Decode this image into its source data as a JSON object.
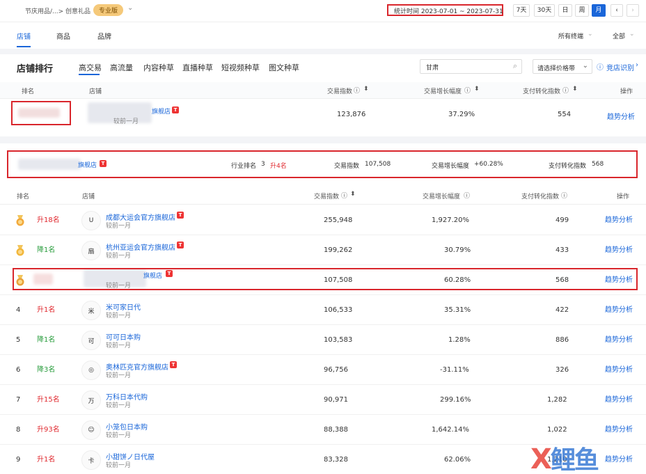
{
  "breadcrumb": {
    "path": "节庆用品/...> 创意礼品",
    "badge": "专业版"
  },
  "date_range": "统计时间 2023-07-01 ~ 2023-07-31",
  "period_buttons": [
    "7天",
    "30天",
    "日",
    "周",
    "月"
  ],
  "nav_tabs": [
    "店铺",
    "商品",
    "品牌"
  ],
  "filters": {
    "terminal": "所有终端",
    "scope": "全部"
  },
  "section_title": "店铺排行",
  "sub_tabs": [
    "高交易",
    "高流量",
    "内容种草",
    "直播种草",
    "短视频种草",
    "图文种草"
  ],
  "search": {
    "value": "甘肃"
  },
  "price_select": "请选择价格带",
  "identify_link": "竞店识别",
  "columns": {
    "rank": "排名",
    "shop": "店铺",
    "trade": "交易指数",
    "growth": "交易增长幅度",
    "conversion": "支付转化指数",
    "action": "操作"
  },
  "pinned_row": {
    "shop_suffix": "旗舰店",
    "compare": "较前一月",
    "trade": "123,876",
    "growth": "37.29%",
    "conversion": "554",
    "action": "趋势分析"
  },
  "summary": {
    "shop_suffix": "旗舰店",
    "industry_rank_label": "行业排名",
    "industry_rank": "3",
    "rank_change": "升4名",
    "trade_label": "交易指数",
    "trade": "107,508",
    "growth_label": "交易增长幅度",
    "growth": "+60.28%",
    "conversion_label": "支付转化指数",
    "conversion": "568"
  },
  "rows": [
    {
      "rank": "",
      "change": "升18名",
      "dir": "up",
      "name": "成都大运会官方旗舰店",
      "tmall": true,
      "compare": "较前一月",
      "trade": "255,948",
      "growth": "1,927.20%",
      "conversion": "499",
      "action": "趋势分析"
    },
    {
      "rank": "",
      "change": "降1名",
      "dir": "down",
      "name": "杭州亚运会官方旗舰店",
      "tmall": true,
      "compare": "较前一月",
      "trade": "199,262",
      "growth": "30.79%",
      "conversion": "433",
      "action": "趋势分析"
    },
    {
      "rank": "",
      "change": "",
      "dir": "",
      "name": "旗舰店",
      "tmall": true,
      "compare": "较前一月",
      "trade": "107,508",
      "growth": "60.28%",
      "conversion": "568",
      "action": "趋势分析"
    },
    {
      "rank": "4",
      "change": "升1名",
      "dir": "up",
      "name": "米可家日代",
      "tmall": false,
      "compare": "较前一月",
      "trade": "106,533",
      "growth": "35.31%",
      "conversion": "422",
      "action": "趋势分析"
    },
    {
      "rank": "5",
      "change": "降1名",
      "dir": "down",
      "name": "可可日本购",
      "tmall": false,
      "compare": "较前一月",
      "trade": "103,583",
      "growth": "1.28%",
      "conversion": "886",
      "action": "趋势分析"
    },
    {
      "rank": "6",
      "change": "降3名",
      "dir": "down",
      "name": "奥林匹克官方旗舰店",
      "tmall": true,
      "compare": "较前一月",
      "trade": "96,756",
      "growth": "-31.11%",
      "conversion": "326",
      "action": "趋势分析"
    },
    {
      "rank": "7",
      "change": "升15名",
      "dir": "up",
      "name": "万科日本代购",
      "tmall": false,
      "compare": "较前一月",
      "trade": "90,971",
      "growth": "299.16%",
      "conversion": "1,282",
      "action": "趋势分析"
    },
    {
      "rank": "8",
      "change": "升93名",
      "dir": "up",
      "name": "小笼包日本购",
      "tmall": false,
      "compare": "较前一月",
      "trade": "88,388",
      "growth": "1,642.14%",
      "conversion": "1,022",
      "action": "趋势分析"
    },
    {
      "rank": "9",
      "change": "升1名",
      "dir": "up",
      "name": "小甜饼ノ日代屋",
      "tmall": false,
      "compare": "较前一月",
      "trade": "83,328",
      "growth": "62.06%",
      "conversion": "1,210",
      "action": "趋势分析"
    }
  ],
  "watermark": "鲤鱼"
}
